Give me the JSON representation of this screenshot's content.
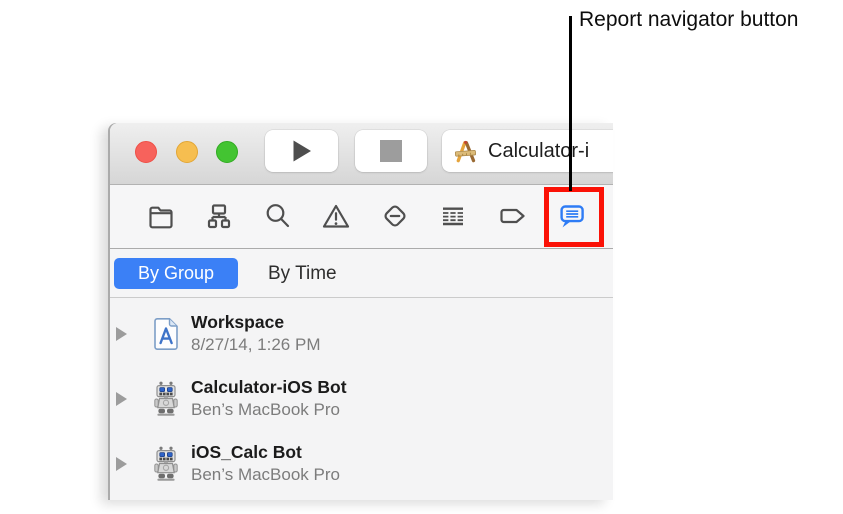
{
  "callout": {
    "label": "Report navigator button",
    "highlight_color": "#fb1207"
  },
  "window": {
    "toolbar": {
      "scheme_text": "Calculator-i",
      "run_icon": "play-icon",
      "stop_icon": "stop-icon",
      "scheme_icon": "xcode-project-icon"
    },
    "navigator_bar": {
      "items": [
        "project-navigator",
        "symbol-navigator",
        "find-navigator",
        "issue-navigator",
        "test-navigator",
        "debug-navigator",
        "breakpoint-navigator",
        "report-navigator"
      ],
      "selected": "report-navigator",
      "selected_color": "#2e7cf5"
    },
    "filter_bar": {
      "options": [
        {
          "label": "By Group",
          "selected": true
        },
        {
          "label": "By Time",
          "selected": false
        }
      ],
      "accent_color": "#3b80f6"
    },
    "report_list": {
      "rows": [
        {
          "icon": "workspace-document-icon",
          "title": "Workspace",
          "subtitle": "8/27/14, 1:26 PM"
        },
        {
          "icon": "bot-icon",
          "title": "Calculator-iOS Bot",
          "subtitle": "Ben’s MacBook Pro"
        },
        {
          "icon": "bot-icon",
          "title": "iOS_Calc Bot",
          "subtitle": "Ben’s MacBook Pro"
        }
      ]
    }
  }
}
